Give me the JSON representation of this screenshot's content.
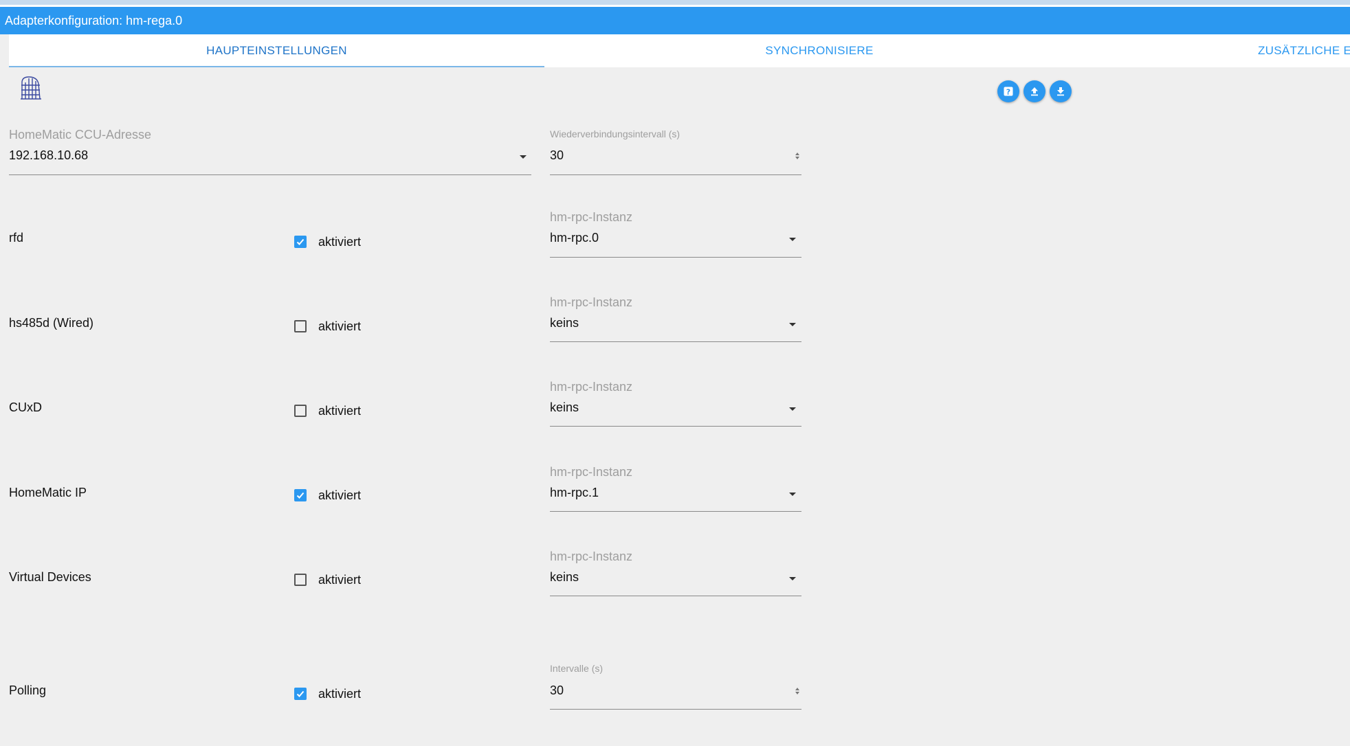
{
  "header": {
    "title": "Adapterkonfiguration: hm-rega.0"
  },
  "tabs": [
    {
      "label": "HAUPTEINSTELLUNGEN",
      "active": true
    },
    {
      "label": "SYNCHRONISIERE",
      "active": false
    },
    {
      "label": "ZUSÄTZLICHE E",
      "active": false
    }
  ],
  "logo": {
    "icon": "homematic-logo",
    "text": "HomeMatic"
  },
  "toolbar": {
    "buttons": [
      "help-icon",
      "upload-icon",
      "download-icon"
    ]
  },
  "ccu_address": {
    "label": "HomeMatic CCU-Adresse",
    "value": "192.168.10.68"
  },
  "reconnect_interval": {
    "label": "Wiederverbindungsintervall (s)",
    "value": "30"
  },
  "check_label": "aktiviert",
  "instance_label": "hm-rpc-Instanz",
  "rows": [
    {
      "label": "rfd",
      "checked": true,
      "instance": "hm-rpc.0"
    },
    {
      "label": "hs485d (Wired)",
      "checked": false,
      "instance": "keins"
    },
    {
      "label": "CUxD",
      "checked": false,
      "instance": "keins"
    },
    {
      "label": "HomeMatic IP",
      "checked": true,
      "instance": "hm-rpc.1"
    },
    {
      "label": "Virtual Devices",
      "checked": false,
      "instance": "keins"
    }
  ],
  "polling": {
    "label": "Polling",
    "checked": true,
    "interval_label": "Intervalle (s)",
    "interval_value": "30"
  },
  "colors": {
    "accent": "#2b98f0",
    "background": "#efefef",
    "tab_active": "#1f74c8"
  }
}
